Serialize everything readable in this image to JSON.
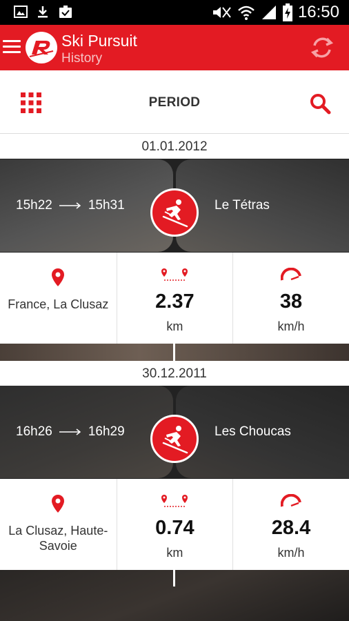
{
  "status_bar": {
    "time": "16:50",
    "left_icons": [
      "gallery-icon",
      "download-icon",
      "clipboard-check-icon"
    ],
    "right_icons": [
      "mute-icon",
      "wifi-icon",
      "signal-icon",
      "battery-charging-icon"
    ]
  },
  "app_bar": {
    "title": "Ski Pursuit",
    "subtitle": "History",
    "logo_icon": "rossignol-r-logo",
    "sync_icon": "sync-icon",
    "accent_color": "#e31b23"
  },
  "filter_bar": {
    "grid_icon": "grid-icon",
    "period_label": "PERIOD",
    "search_icon": "search-icon"
  },
  "runs": [
    {
      "date": "01.01.2012",
      "start_time": "15h22",
      "end_time": "15h31",
      "slope": "Le Tétras",
      "location": "France, La Clusaz",
      "distance_value": "2.37",
      "distance_unit": "km",
      "speed_value": "38",
      "speed_unit": "km/h"
    },
    {
      "date": "30.12.2011",
      "start_time": "16h26",
      "end_time": "16h29",
      "slope": "Les Choucas",
      "location": "La Clusaz, Haute-Savoie",
      "distance_value": "0.74",
      "distance_unit": "km",
      "speed_value": "28.4",
      "speed_unit": "km/h"
    }
  ]
}
